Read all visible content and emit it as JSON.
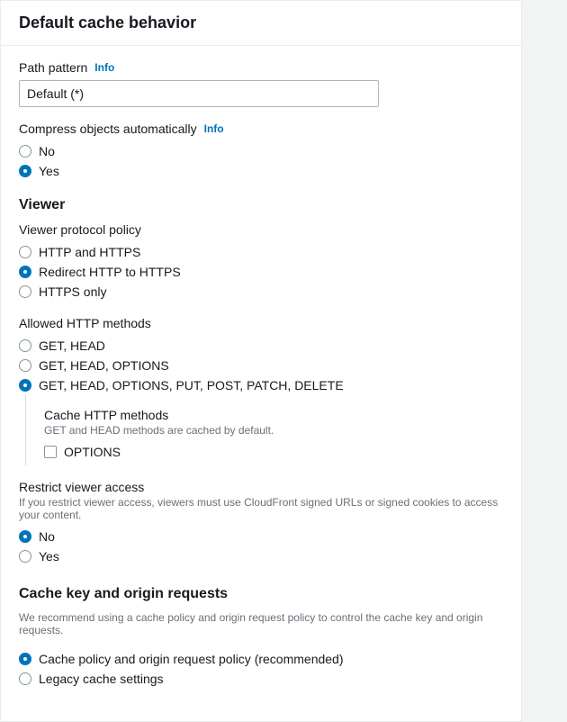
{
  "card": {
    "title": "Default cache behavior"
  },
  "pathPattern": {
    "label": "Path pattern",
    "info": "Info",
    "value": "Default (*)"
  },
  "compress": {
    "label": "Compress objects automatically",
    "info": "Info",
    "no": "No",
    "yes": "Yes"
  },
  "viewer": {
    "heading": "Viewer",
    "protocol": {
      "label": "Viewer protocol policy",
      "opt1": "HTTP and HTTPS",
      "opt2": "Redirect HTTP to HTTPS",
      "opt3": "HTTPS only"
    },
    "methods": {
      "label": "Allowed HTTP methods",
      "opt1": "GET, HEAD",
      "opt2": "GET, HEAD, OPTIONS",
      "opt3": "GET, HEAD, OPTIONS, PUT, POST, PATCH, DELETE",
      "cacheTitle": "Cache HTTP methods",
      "cacheHelp": "GET and HEAD methods are cached by default.",
      "optionsLabel": "OPTIONS"
    },
    "restrict": {
      "label": "Restrict viewer access",
      "help": "If you restrict viewer access, viewers must use CloudFront signed URLs or signed cookies to access your content.",
      "no": "No",
      "yes": "Yes"
    }
  },
  "cacheKey": {
    "heading": "Cache key and origin requests",
    "help": "We recommend using a cache policy and origin request policy to control the cache key and origin requests.",
    "opt1": "Cache policy and origin request policy (recommended)",
    "opt2": "Legacy cache settings"
  }
}
